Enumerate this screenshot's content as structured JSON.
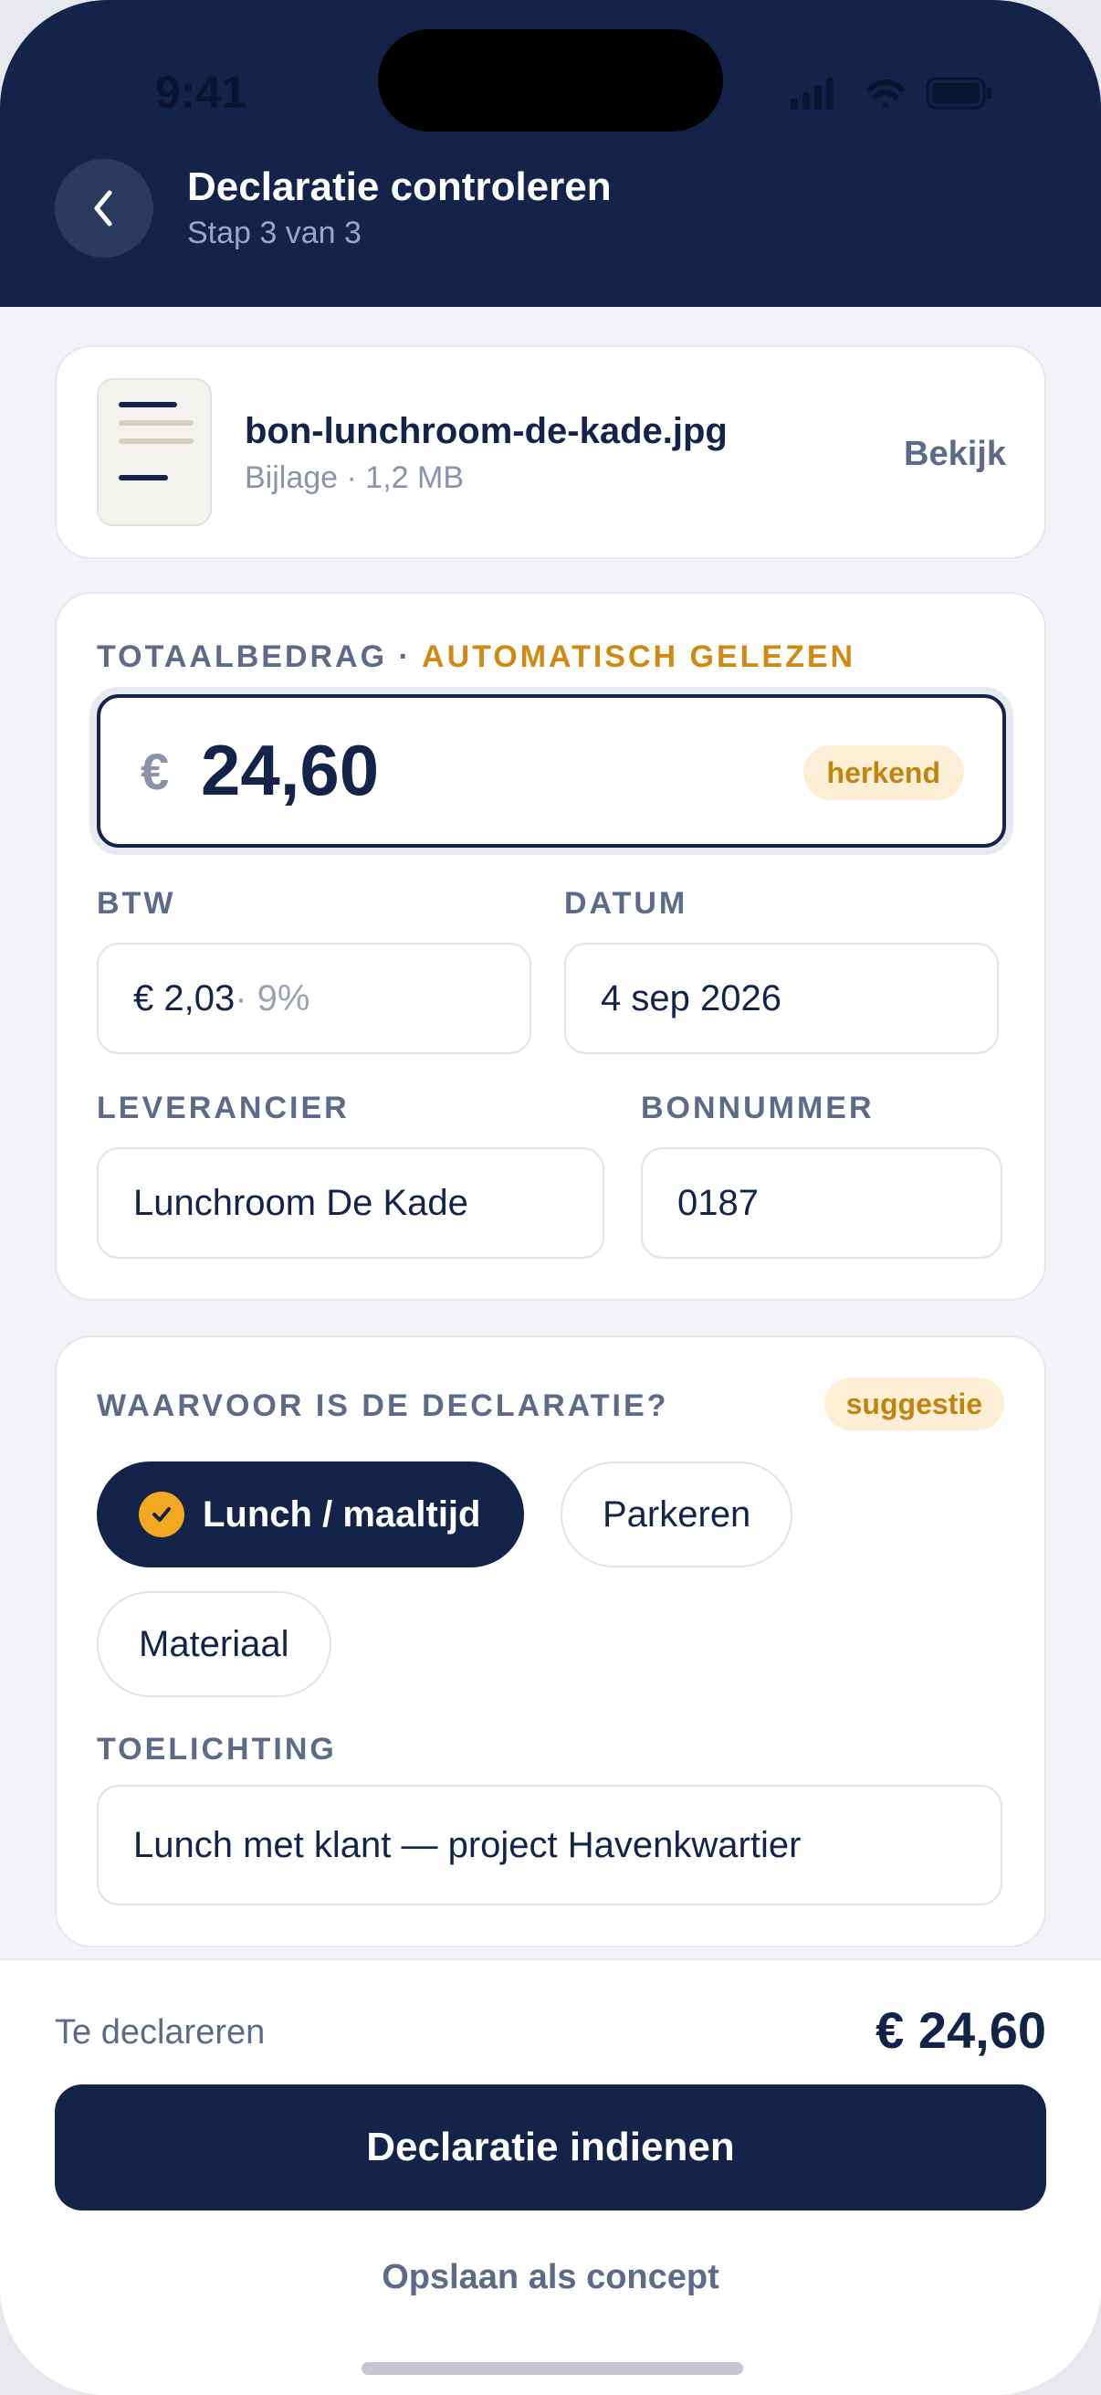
{
  "status_bar": {
    "time": "9:41"
  },
  "header": {
    "title": "Declaratie controleren",
    "subtitle": "Stap 3 van 3"
  },
  "attachment": {
    "file_name": "bon-lunchroom-de-kade.jpg",
    "meta": "Bijlage · 1,2 MB",
    "view_label": "Bekijk"
  },
  "amount": {
    "label": "TOTAALBEDRAG · ",
    "label_accent": "AUTOMATISCH GELEZEN",
    "currency": "€",
    "value": "24,60",
    "badge": "herkend"
  },
  "fields": {
    "btw_label": "BTW",
    "btw_value": "€ 2,03",
    "btw_rate": " · 9%",
    "date_label": "DATUM",
    "date_value": "4 sep 2026",
    "supplier_label": "LEVERANCIER",
    "supplier_value": "Lunchroom De Kade",
    "receipt_label": "BONNUMMER",
    "receipt_value": "0187"
  },
  "category": {
    "question": "WAARVOOR IS DE DECLARATIE?",
    "badge": "suggestie",
    "options": [
      {
        "label": "Lunch / maaltijd",
        "selected": true
      },
      {
        "label": "Parkeren",
        "selected": false
      },
      {
        "label": "Materiaal",
        "selected": false
      }
    ],
    "note_label": "TOELICHTING",
    "note_value": "Lunch met klant — project Havenkwartier"
  },
  "footer": {
    "total_label": "Te declareren",
    "total_value": "€ 24,60",
    "submit_label": "Declaratie indienen",
    "draft_label": "Opslaan als concept"
  },
  "colors": {
    "navy": "#13234a",
    "accent": "#d08a13",
    "badge_bg": "#fcefd6",
    "check": "#f2a820"
  }
}
